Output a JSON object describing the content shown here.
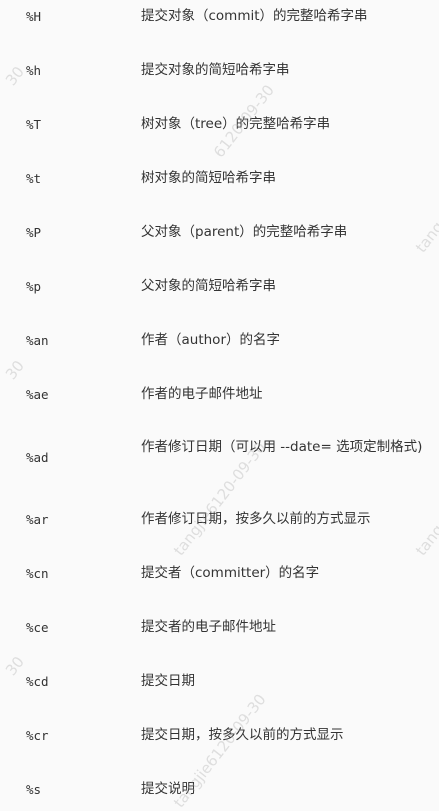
{
  "rows": [
    {
      "fmt": "%H",
      "desc": "提交对象（commit）的完整哈希字串"
    },
    {
      "fmt": "%h",
      "desc": "提交对象的简短哈希字串"
    },
    {
      "fmt": "%T",
      "desc": "树对象（tree）的完整哈希字串"
    },
    {
      "fmt": "%t",
      "desc": "树对象的简短哈希字串"
    },
    {
      "fmt": "%P",
      "desc": "父对象（parent）的完整哈希字串"
    },
    {
      "fmt": "%p",
      "desc": "父对象的简短哈希字串"
    },
    {
      "fmt": "%an",
      "desc": "作者（author）的名字"
    },
    {
      "fmt": "%ae",
      "desc": "作者的电子邮件地址"
    },
    {
      "fmt": "%ad",
      "desc": "作者修订日期（可以用 --date= 选项定制格式)"
    },
    {
      "fmt": "%ar",
      "desc": "作者修订日期，按多久以前的方式显示"
    },
    {
      "fmt": "%cn",
      "desc": "提交者（committer）的名字"
    },
    {
      "fmt": "%ce",
      "desc": "提交者的电子邮件地址"
    },
    {
      "fmt": "%cd",
      "desc": "提交日期"
    },
    {
      "fmt": "%cr",
      "desc": "提交日期，按多久以前的方式显示"
    },
    {
      "fmt": "%s",
      "desc": "提交说明"
    }
  ],
  "watermark": {
    "text": "tangjie6120-09-30",
    "text_short": "6120-09-30",
    "text_edge": "tang",
    "text_num": "30"
  }
}
